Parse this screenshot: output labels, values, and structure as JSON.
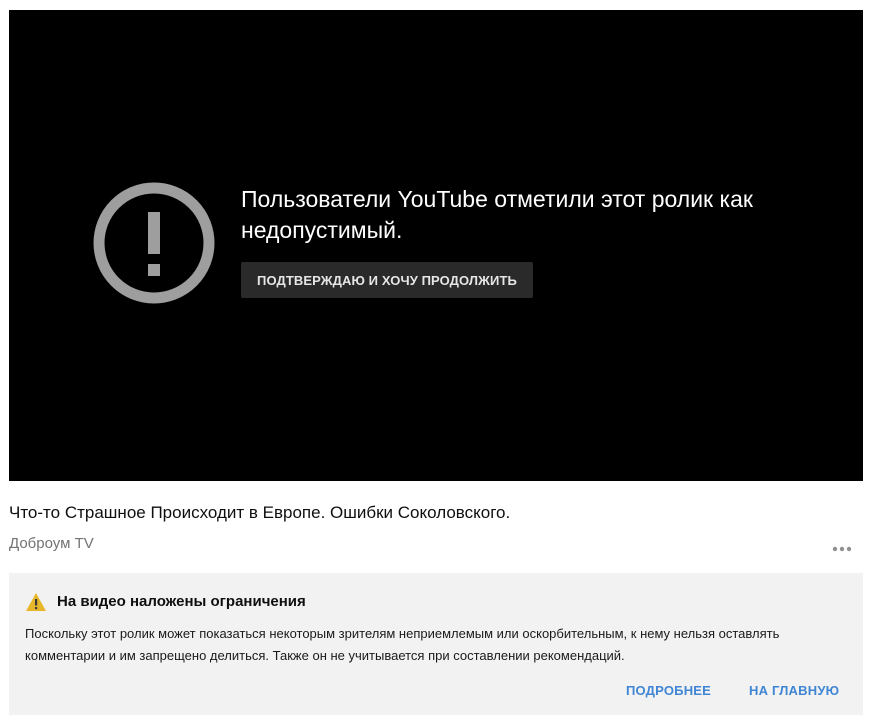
{
  "player": {
    "warning_message": "Пользователи YouTube отметили этот ролик как недопустимый.",
    "confirm_button_label": "ПОДТВЕРЖДАЮ И ХОЧУ ПРОДОЛЖИТЬ",
    "warning_icon": "exclamation-circle-icon"
  },
  "video": {
    "title": "Что-то Страшное Происходит в Европе. Ошибки Соколовского.",
    "channel": "Доброум TV",
    "more_icon": "more-horizontal-icon"
  },
  "restriction": {
    "icon": "caution-triangle-icon",
    "title": "На видео наложены ограничения",
    "description": "Поскольку этот ролик может показаться некоторым зрителям неприемлемым или оскорбительным, к нему нельзя оставлять комментарии и им запрещено делиться. Также он не учитывается при составлении рекомендаций.",
    "learn_more_label": "ПОДРОБНЕЕ",
    "home_label": "НА ГЛАВНУЮ"
  },
  "colors": {
    "player_background": "#000000",
    "icon_gray": "#9e9e9e",
    "link_blue": "#3f85d4",
    "caution_yellow": "#e7b62a",
    "panel_background": "#f2f2f2"
  }
}
